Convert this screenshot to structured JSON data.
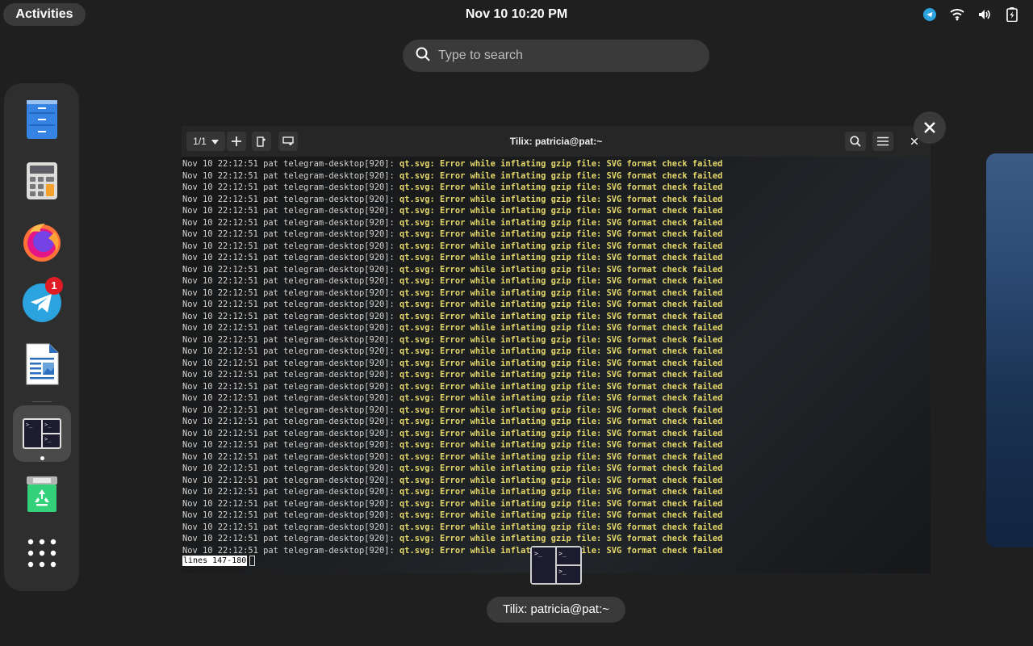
{
  "topbar": {
    "activities": "Activities",
    "clock": "Nov 10  10:20 PM",
    "tray_icons": [
      "telegram-icon",
      "wifi-icon",
      "volume-icon",
      "battery-icon"
    ]
  },
  "search": {
    "placeholder": "Type to search"
  },
  "dash": {
    "items": [
      {
        "name": "Files",
        "icon": "files-icon"
      },
      {
        "name": "Calculator",
        "icon": "calculator-icon"
      },
      {
        "name": "Firefox",
        "icon": "firefox-icon"
      },
      {
        "name": "Telegram",
        "icon": "telegram-icon",
        "badge": "1"
      },
      {
        "name": "LibreOffice Writer",
        "icon": "writer-icon"
      },
      {
        "name": "Tilix",
        "icon": "terminal-icon",
        "running": true
      },
      {
        "name": "Trash",
        "icon": "trash-icon"
      },
      {
        "name": "Show Applications",
        "icon": "app-grid-icon"
      }
    ]
  },
  "window": {
    "title": "Tilix: patricia@pat:~",
    "session_counter": "1/1",
    "caption": "Tilix: patricia@pat:~",
    "log_prefix": "Nov 10 22:12:51 pat telegram-desktop[920]: ",
    "log_message": "qt.svg: Error while inflating gzip file: SVG format check failed",
    "log_line_count": 34,
    "status_line": "lines 147-180"
  },
  "colors": {
    "panel": "#3a3a3a",
    "log_highlight": "#e5d96b",
    "badge": "#e01b24"
  }
}
